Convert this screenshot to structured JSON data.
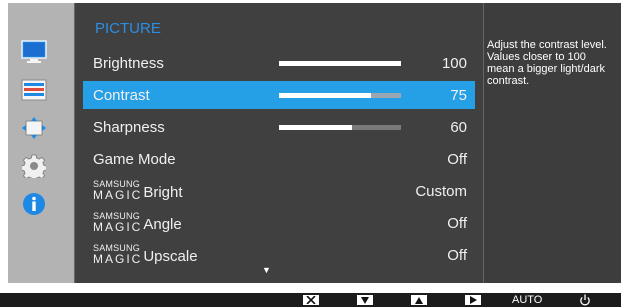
{
  "menu": {
    "title": "PICTURE",
    "rows": [
      {
        "label": "Brightness",
        "value": "100",
        "level": 1.0
      },
      {
        "label": "Contrast",
        "value": "75",
        "level": 0.75,
        "selected": true
      },
      {
        "label": "Sharpness",
        "value": "60",
        "level": 0.6
      },
      {
        "label": "Game Mode",
        "value": "Off"
      },
      {
        "prefix_top": "SAMSUNG",
        "prefix_bottom": "MAGIC",
        "label": "Bright",
        "value": "Custom"
      },
      {
        "prefix_top": "SAMSUNG",
        "prefix_bottom": "MAGIC",
        "label": "Angle",
        "value": "Off"
      },
      {
        "prefix_top": "SAMSUNG",
        "prefix_bottom": "MAGIC",
        "label": "Upscale",
        "value": "Off"
      }
    ],
    "scroll_indicator": "▼"
  },
  "help": {
    "text": "Adjust the contrast level. Values closer to 100 mean a bigger light/dark contrast."
  },
  "sidebar": {
    "icons": [
      "picture-monitor-icon",
      "onscreen-display-icon",
      "size-position-icon",
      "setup-gear-icon",
      "information-icon"
    ]
  },
  "bottom_bar": {
    "buttons": [
      "close",
      "down",
      "up",
      "enter"
    ],
    "auto_label": "AUTO",
    "power": "power"
  },
  "colors": {
    "highlight": "#25a0e6",
    "title": "#2b8ee6",
    "panel": "#404040",
    "frame": "#b3b3b3",
    "info": "#1e88e5"
  }
}
